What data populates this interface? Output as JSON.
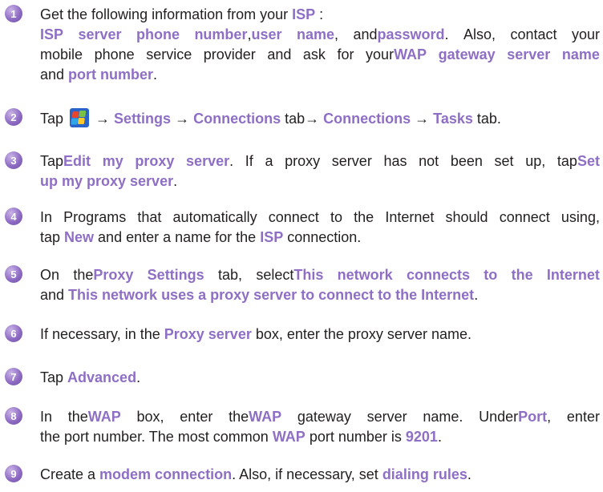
{
  "steps": [
    {
      "number": "1",
      "lines": [
        [
          {
            "t": "Get the following information from your "
          },
          {
            "b": "ISP"
          },
          {
            "t": " :"
          }
        ],
        [
          {
            "b": "ISP server phone number"
          },
          {
            "t": ", "
          },
          {
            "b": "user name"
          },
          {
            "t": ", and "
          },
          {
            "b": "password"
          },
          {
            "t": ". Also, contact your"
          }
        ],
        [
          {
            "t": "mobile phone service provider and ask for your "
          },
          {
            "b": "WAP gateway server name"
          }
        ],
        [
          {
            "t": "and "
          },
          {
            "b": "port number"
          },
          {
            "t": "."
          }
        ]
      ]
    },
    {
      "number": "2",
      "lines": [
        [
          {
            "t": "Tap "
          },
          {
            "icon": "windows-start-icon"
          },
          {
            "t": " → "
          },
          {
            "b": "Settings"
          },
          {
            "t": " → "
          },
          {
            "b": "Connections"
          },
          {
            "t": " tab→ "
          },
          {
            "b": "Connections"
          },
          {
            "t": " → "
          },
          {
            "b": "Tasks"
          },
          {
            "t": " tab."
          }
        ]
      ]
    },
    {
      "number": "3",
      "lines": [
        [
          {
            "t": "Tap "
          },
          {
            "b": "Edit my proxy server"
          },
          {
            "t": ". If a proxy server has not been set up, tap "
          },
          {
            "b": "Set"
          }
        ],
        [
          {
            "b": "up my proxy server"
          },
          {
            "t": "."
          }
        ]
      ]
    },
    {
      "number": "4",
      "lines": [
        [
          {
            "t": "In Programs that automatically connect to the Internet should connect using,"
          }
        ],
        [
          {
            "t": "tap "
          },
          {
            "b": "New"
          },
          {
            "t": " and enter a name for the "
          },
          {
            "b": "ISP"
          },
          {
            "t": " connection."
          }
        ]
      ]
    },
    {
      "number": "5",
      "lines": [
        [
          {
            "t": "On the "
          },
          {
            "b": "Proxy Settings"
          },
          {
            "t": " tab, select "
          },
          {
            "b": "This network connects to the Internet"
          }
        ],
        [
          {
            "t": "and "
          },
          {
            "b": "This network uses a proxy server to connect to the Internet"
          },
          {
            "t": "."
          }
        ]
      ]
    },
    {
      "number": "6",
      "lines": [
        [
          {
            "t": "If necessary, in the "
          },
          {
            "b": "Proxy server"
          },
          {
            "t": " box, enter the proxy server name."
          }
        ]
      ]
    },
    {
      "number": "7",
      "lines": [
        [
          {
            "t": "Tap "
          },
          {
            "b": "Advanced"
          },
          {
            "t": "."
          }
        ]
      ]
    },
    {
      "number": "8",
      "lines": [
        [
          {
            "t": "In the "
          },
          {
            "b": "WAP"
          },
          {
            "t": " box, enter the "
          },
          {
            "b": "WAP"
          },
          {
            "t": " gateway server name. Under "
          },
          {
            "b": "Port"
          },
          {
            "t": ", enter"
          }
        ],
        [
          {
            "t": "the port number. The most common "
          },
          {
            "b": "WAP"
          },
          {
            "t": " port number is "
          },
          {
            "b": "9201"
          },
          {
            "t": "."
          }
        ]
      ]
    },
    {
      "number": "9",
      "lines": [
        [
          {
            "t": "Create a "
          },
          {
            "b": "modem connection"
          },
          {
            "t": ". Also, if necessary, set "
          },
          {
            "b": "dialing rules"
          },
          {
            "t": "."
          }
        ]
      ]
    }
  ]
}
